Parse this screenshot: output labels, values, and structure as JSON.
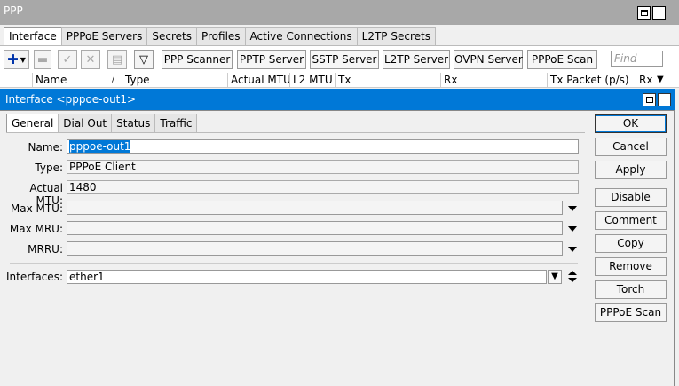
{
  "ppp_window": {
    "title": "PPP",
    "tabs": [
      "Interface",
      "PPPoE Servers",
      "Secrets",
      "Profiles",
      "Active Connections",
      "L2TP Secrets"
    ],
    "toolbar": {
      "add_icon": "plus-icon",
      "buttons": [
        "PPP Scanner",
        "PPTP Server",
        "SSTP Server",
        "L2TP Server",
        "OVPN Server",
        "PPPoE Scan"
      ],
      "find_placeholder": "Find"
    },
    "columns": [
      "Name",
      "Type",
      "Actual MTU",
      "L2 MTU",
      "Tx",
      "Rx",
      "Tx Packet (p/s)",
      "Rx"
    ]
  },
  "dialog": {
    "title": "Interface <pppoe-out1>",
    "tabs": [
      "General",
      "Dial Out",
      "Status",
      "Traffic"
    ],
    "fields": {
      "name_label": "Name:",
      "name_value": "pppoe-out1",
      "type_label": "Type:",
      "type_value": "PPPoE Client",
      "actual_mtu_label": "Actual MTU:",
      "actual_mtu_value": "1480",
      "max_mtu_label": "Max MTU:",
      "max_mtu_value": "",
      "max_mru_label": "Max MRU:",
      "max_mru_value": "",
      "mrru_label": "MRRU:",
      "mrru_value": "",
      "interfaces_label": "Interfaces:",
      "interfaces_value": "ether1"
    },
    "buttons": [
      "OK",
      "Cancel",
      "Apply",
      "Disable",
      "Comment",
      "Copy",
      "Remove",
      "Torch",
      "PPPoE Scan"
    ]
  },
  "colors": {
    "title_active": "#0078d7",
    "title_inactive": "#a8a8a8",
    "add_icon": "#0033aa"
  }
}
